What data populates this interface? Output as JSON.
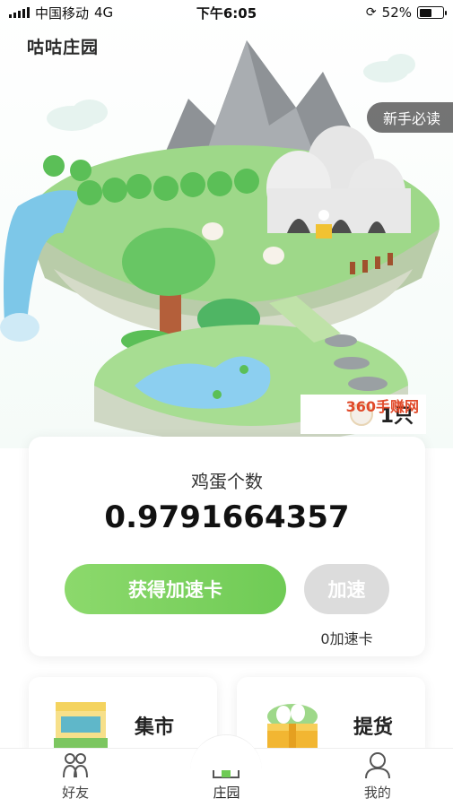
{
  "status_bar": {
    "carrier": "中国移动",
    "network": "4G",
    "time": "下午6:05",
    "battery_percent": "52%",
    "battery_level": 0.52
  },
  "header": {
    "logo": "咕咕庄园",
    "guide_button": "新手必读"
  },
  "hero": {
    "chick_count": "1只",
    "watermark": "360手赚网"
  },
  "egg_card": {
    "label": "鸡蛋个数",
    "value": "0.9791664357",
    "get_speed_card_label": "获得加速卡",
    "speed_up_label": "加速",
    "speed_card_count": "0加速卡"
  },
  "shortcuts": {
    "market_label": "集市",
    "pickup_label": "提货"
  },
  "tabbar": {
    "tabs": [
      {
        "label": "好友",
        "icon": "friends-icon"
      },
      {
        "label": "庄园",
        "icon": "farm-house-icon"
      },
      {
        "label": "我的",
        "icon": "profile-icon"
      }
    ],
    "active": "庄园"
  },
  "colors": {
    "primary_green": "#6fcb55",
    "disabled_gray": "#dcdcdc"
  }
}
